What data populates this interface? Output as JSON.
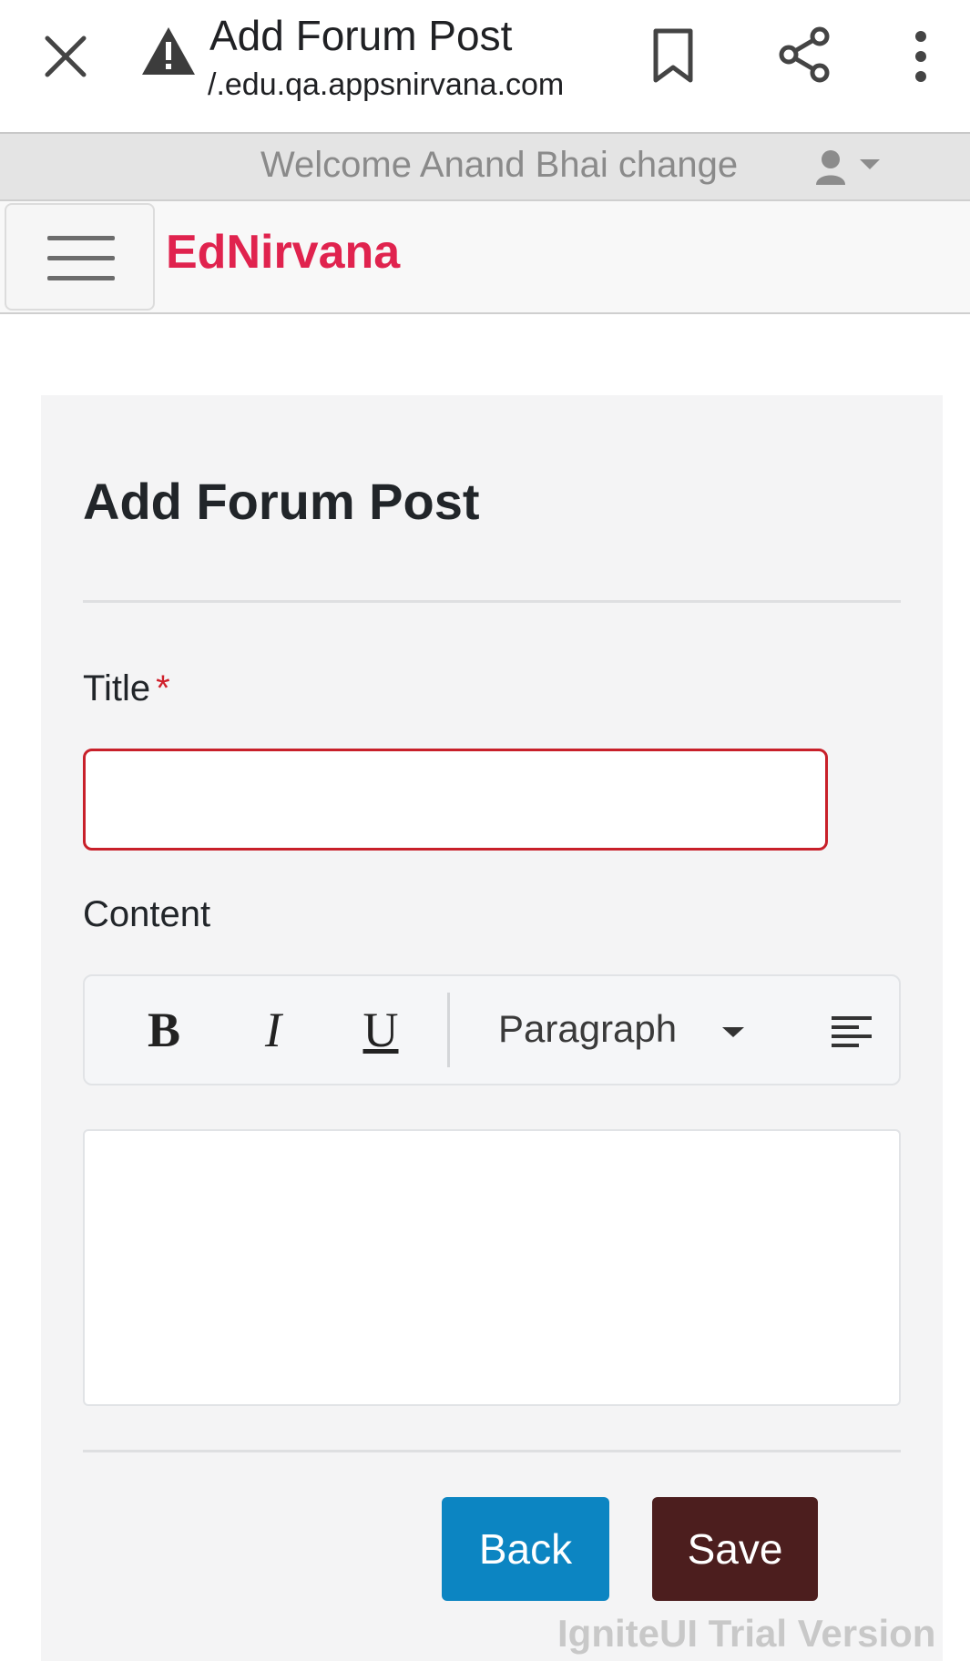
{
  "browser": {
    "page_title": "Add Forum Post",
    "url": "/.edu.qa.appsnirvana.com"
  },
  "header": {
    "welcome_text": "Welcome Anand Bhai change"
  },
  "navbar": {
    "brand": "EdNirvana",
    "brand_color": "#e0234e"
  },
  "form": {
    "heading": "Add Forum Post",
    "title_label": "Title",
    "required_marker": "*",
    "title_value": "",
    "content_label": "Content",
    "toolbar": {
      "bold": "B",
      "italic": "I",
      "underline": "U",
      "block_format": "Paragraph"
    },
    "content_value": ""
  },
  "actions": {
    "back_label": "Back",
    "save_label": "Save",
    "back_color": "#0c85c2",
    "save_color": "#4c1e1e"
  },
  "watermark": "IgniteUI Trial Version"
}
